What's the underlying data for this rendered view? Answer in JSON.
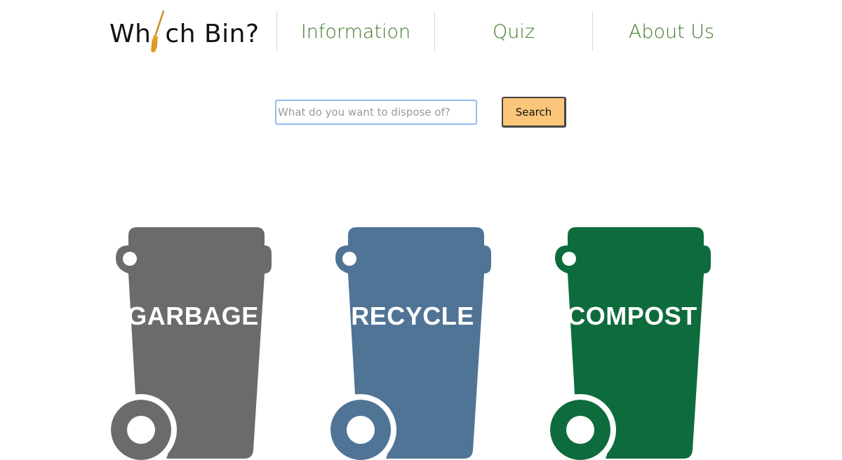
{
  "header": {
    "logo_text_before": "Wh",
    "logo_text_after": "ch Bin?",
    "nav": [
      {
        "label": "Information"
      },
      {
        "label": "Quiz"
      },
      {
        "label": "About Us"
      }
    ],
    "nav_color": "#3e7a2c"
  },
  "search": {
    "placeholder": "What do you want to dispose of?",
    "value": "",
    "button_label": "Search",
    "button_color": "#fbc57a"
  },
  "bins": [
    {
      "label": "GARBAGE",
      "color": "#6b6b6b"
    },
    {
      "label": "RECYCLE",
      "color": "#507496"
    },
    {
      "label": "COMPOST",
      "color": "#0e6b3c"
    }
  ]
}
